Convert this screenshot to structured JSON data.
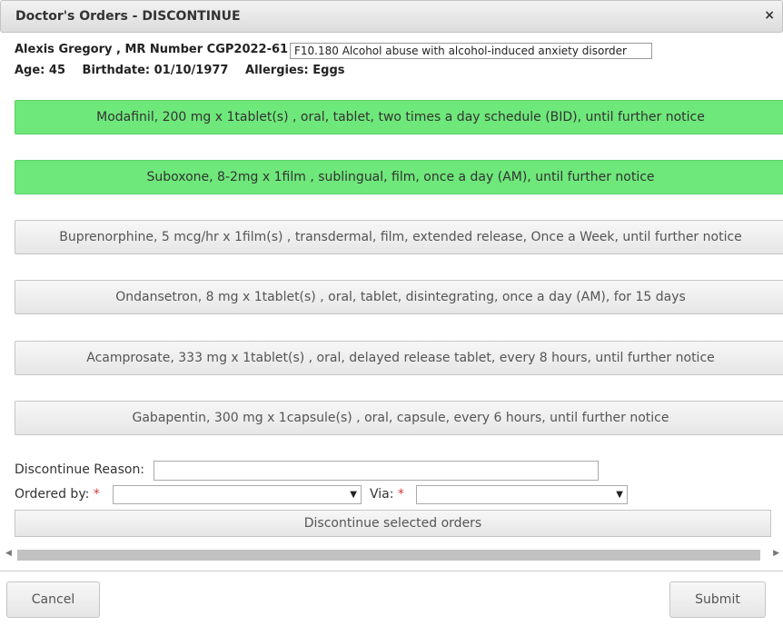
{
  "dialog": {
    "title": "Doctor's Orders - DISCONTINUE",
    "close_glyph": "×"
  },
  "patient": {
    "name_mr": "Alexis Gregory , MR Number CGP2022-61",
    "diagnosis": "F10.180 Alcohol abuse with alcohol-induced anxiety disorder",
    "age": "Age: 45",
    "birthdate": "Birthdate: 01/10/1977",
    "allergies": "Allergies: Eggs"
  },
  "orders": [
    {
      "label": "Modafinil, 200 mg x 1tablet(s) , oral, tablet, two times a day schedule (BID), until further notice",
      "selected": true
    },
    {
      "label": "Suboxone, 8-2mg x 1film , sublingual, film, once a day (AM), until further notice",
      "selected": true
    },
    {
      "label": "Buprenorphine, 5 mcg/hr x 1film(s) , transdermal, film, extended release, Once a Week, until further notice",
      "selected": false
    },
    {
      "label": "Ondansetron, 8 mg x 1tablet(s) , oral, tablet, disintegrating, once a day (AM), for 15 days",
      "selected": false
    },
    {
      "label": "Acamprosate, 333 mg x 1tablet(s) , oral, delayed release tablet, every 8 hours, until further notice",
      "selected": false
    },
    {
      "label": "Gabapentin, 300 mg x 1capsule(s) , oral, capsule, every 6 hours, until further notice",
      "selected": false
    }
  ],
  "form": {
    "reason_label": "Discontinue Reason:",
    "reason_value": "",
    "ordered_by_label": "Ordered by:",
    "ordered_by_value": "",
    "via_label": "Via:",
    "via_value": "",
    "required_mark": "*",
    "discontinue_button": "Discontinue selected orders"
  },
  "scrollbar": {
    "left_arrow": "◀",
    "right_arrow": "▶"
  },
  "footer": {
    "cancel": "Cancel",
    "submit": "Submit"
  },
  "colors": {
    "selected_order": "#6ee87a",
    "required": "#d43b3b"
  }
}
